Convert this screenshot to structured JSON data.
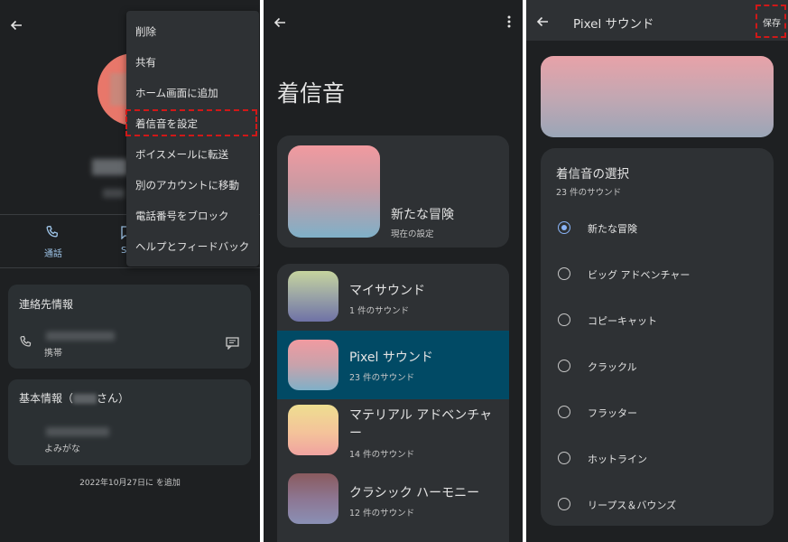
{
  "panel1": {
    "call_label": "通話",
    "sms_label_partial": "S",
    "contact_info_title": "連絡先情報",
    "phone_type": "携帯",
    "basic_info_prefix": "基本情報（",
    "basic_info_suffix": "さん）",
    "reading_label": "よみがな",
    "added_text": "2022年10月27日に を追加",
    "menu": {
      "items": [
        "削除",
        "共有",
        "ホーム画面に追加",
        "着信音を設定",
        "ボイスメールに転送",
        "別のアカウントに移動",
        "電話番号をブロック",
        "ヘルプとフィードバック"
      ]
    },
    "avatar_color": "#e8776a",
    "highlight_color": "#d01818"
  },
  "panel2": {
    "title": "着信音",
    "current": {
      "name": "新たな冒険",
      "subtitle": "現在の設定"
    },
    "items": [
      {
        "title": "マイサウンド",
        "subtitle": "1 件のサウンド"
      },
      {
        "title": "Pixel サウンド",
        "subtitle": "23 件のサウンド"
      },
      {
        "title": "マテリアル アドベンチャー",
        "subtitle": "14 件のサウンド"
      },
      {
        "title": "クラシック ハーモニー",
        "subtitle": "12 件のサウンド"
      }
    ],
    "selected_row_color": "#014a65"
  },
  "panel3": {
    "title": "Pixel サウンド",
    "save_label": "保存",
    "section_title": "着信音の選択",
    "section_subtitle": "23 件のサウンド",
    "options": [
      "新たな冒険",
      "ビッグ アドベンチャー",
      "コピーキャット",
      "クラックル",
      "フラッター",
      "ホットライン",
      "リープス＆バウンズ"
    ],
    "selected_option": "新たな冒険",
    "accent_color": "#8ab4f8"
  }
}
